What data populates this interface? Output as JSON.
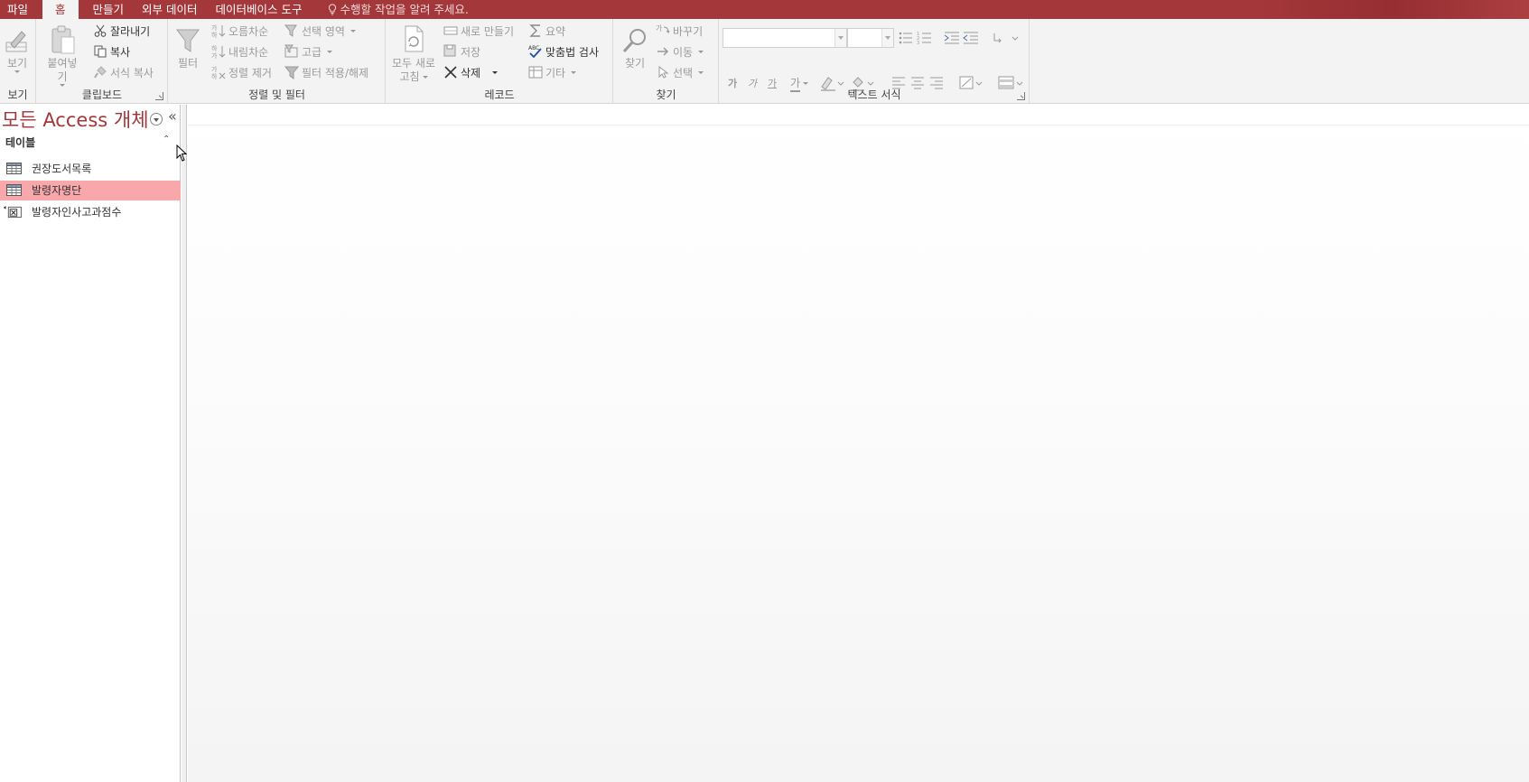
{
  "tabs": {
    "file": "파일",
    "home": "홈",
    "create": "만들기",
    "external": "외부 데이터",
    "dbtools": "데이터베이스 도구",
    "tell_me": "수행할 작업을 알려 주세요."
  },
  "ribbon": {
    "views": {
      "view": "보기",
      "label": "보기"
    },
    "clipboard": {
      "paste": "붙여넣기",
      "cut": "잘라내기",
      "copy": "복사",
      "format_painter": "서식 복사",
      "label": "클립보드"
    },
    "sort_filter": {
      "filter": "필터",
      "ascending": "오름차순",
      "descending": "내림차순",
      "remove_sort": "정렬 제거",
      "selection": "선택 영역",
      "advanced": "고급",
      "toggle_filter": "필터 적용/해제",
      "label": "정렬 및 필터"
    },
    "records": {
      "refresh_all_line1": "모두 새로",
      "refresh_all_line2": "고침",
      "new": "새로 만들기",
      "save": "저장",
      "delete": "삭제",
      "totals": "요약",
      "spelling": "맞춤법 검사",
      "more": "기타",
      "label": "레코드"
    },
    "find": {
      "find": "찾기",
      "replace": "바꾸기",
      "goto": "이동",
      "select": "선택",
      "label": "찾기"
    },
    "text_format": {
      "bold": "가",
      "italic": "가",
      "underline": "가",
      "font_color": "가",
      "label": "텍스트 서식"
    }
  },
  "nav": {
    "title": "모든 Access 개체",
    "collapse": "«",
    "section": "테이블",
    "section_toggle": "⌃",
    "items": [
      {
        "label": "권장도서목록",
        "type": "table"
      },
      {
        "label": "발령자명단",
        "type": "table",
        "selected": true
      },
      {
        "label": "발령자인사고과점수",
        "type": "linked-excel"
      }
    ]
  },
  "colors": {
    "accent": "#a4373a",
    "selected_row": "#f8a7ab",
    "ribbon_bg": "#f3f3f3"
  }
}
